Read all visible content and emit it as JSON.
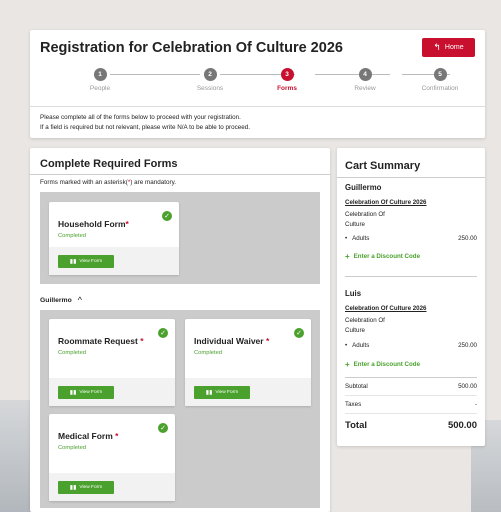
{
  "header": {
    "title": "Registration for Celebration Of Culture 2026",
    "home_label": "Home",
    "steps": [
      {
        "num": "1",
        "label": "People"
      },
      {
        "num": "2",
        "label": "Sessions"
      },
      {
        "num": "3",
        "label": "Forms"
      },
      {
        "num": "4",
        "label": "Review"
      },
      {
        "num": "5",
        "label": "Confirmation"
      }
    ],
    "active_step": 3,
    "info_line1": "Please complete all of the forms below to proceed with your registration.",
    "info_line2": "If a field is required but not relevant, please write N/A to be able to proceed."
  },
  "forms": {
    "title": "Complete Required Forms",
    "note_pre": "Forms marked with an asterisk(",
    "note_ast": "*",
    "note_post": ") are mandatory.",
    "household": {
      "name": "Household Form",
      "req": "*",
      "status": "Completed",
      "view_label": "View Form"
    },
    "guest_name": "Guillermo",
    "guest_cards": [
      {
        "name": "Roommate Request ",
        "req": "*",
        "status": "Completed",
        "view_label": "View Form"
      },
      {
        "name": "Individual Waiver ",
        "req": "*",
        "status": "Completed",
        "view_label": "View Form"
      },
      {
        "name": "Medical Form ",
        "req": "*",
        "status": "Completed",
        "view_label": "View Form"
      }
    ]
  },
  "cart": {
    "title": "Cart Summary",
    "guests": [
      {
        "name": "Guillermo",
        "event": "Celebration Of Culture 2026",
        "event_lines": [
          "Celebration Of",
          "Culture"
        ],
        "item": "Adults",
        "amount": "250.00",
        "discount": "Enter a Discount Code"
      },
      {
        "name": "Luis",
        "event": "Celebration Of Culture 2026",
        "event_lines": [
          "Celebration Of",
          "Culture"
        ],
        "item": "Adults",
        "amount": "250.00",
        "discount": "Enter a Discount Code"
      }
    ],
    "subtotal_label": "Subtotal",
    "subtotal": "500.00",
    "taxes_label": "Taxes",
    "taxes": "-",
    "total_label": "Total",
    "total": "500.00"
  }
}
